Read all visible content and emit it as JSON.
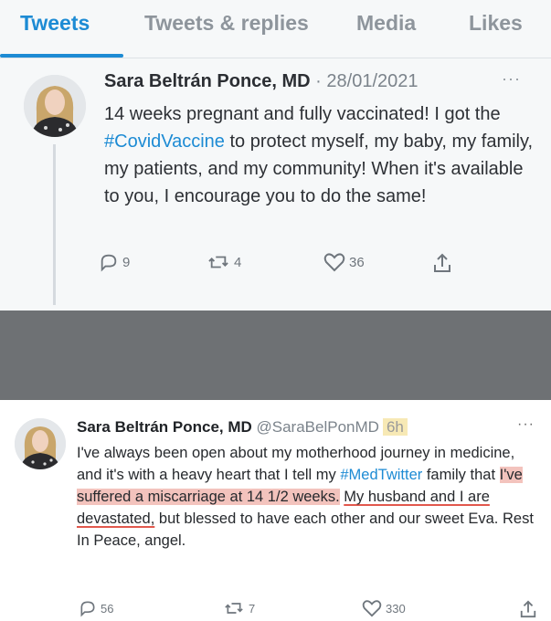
{
  "tabs": [
    {
      "label": "Tweets",
      "active": true
    },
    {
      "label": "Tweets & replies",
      "active": false
    },
    {
      "label": "Media",
      "active": false
    },
    {
      "label": "Likes",
      "active": false
    }
  ],
  "tweet1": {
    "name": "Sara Beltrán Ponce, MD",
    "date": " · 28/01/2021",
    "more": "···",
    "text_before": "14 weeks pregnant and fully vaccinated! I got the ",
    "hashtag": "#CovidVaccine",
    "text_after": " to protect myself, my baby, my family, my patients, and my community! When it's available to you, I encourage you to do the same!",
    "replies": "9",
    "retweets": "4",
    "likes": "36"
  },
  "tweet2": {
    "name": "Sara Beltrán Ponce, MD",
    "handle": " @SaraBelPonMD",
    "time": "6h",
    "more": "···",
    "text1": "I've always been open about my motherhood journey in medicine, and it's with a heavy heart that I tell my ",
    "hashtag": "#MedTwitter",
    "text2": " family that ",
    "highlight": "I've suffered a miscarriage at 14 1/2 weeks.",
    "text3": " ",
    "underlined": "My husband and I are devastated,",
    "text4": " but blessed to have each other and our sweet Eva. Rest In Peace, angel.",
    "replies": "56",
    "retweets": "7",
    "likes": "330"
  },
  "colors": {
    "accent": "#1d8bd4",
    "highlight_red": "#f3c3bd",
    "highlight_yellow": "#f7e9b5",
    "separator": "#6e7174"
  }
}
